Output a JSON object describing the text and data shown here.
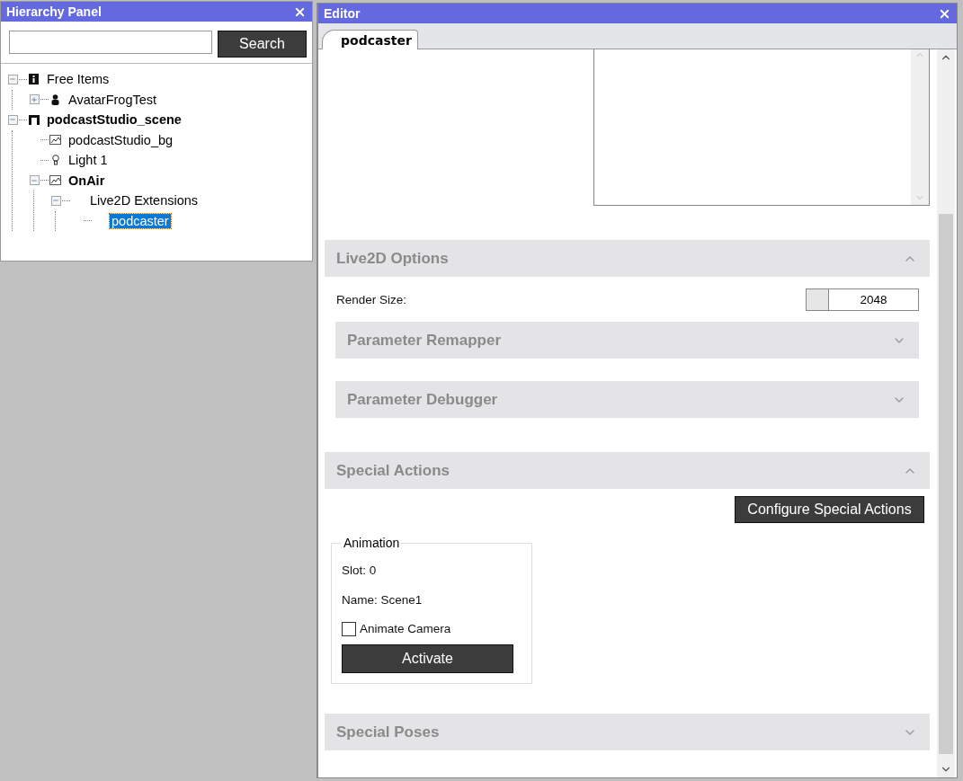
{
  "hierarchy_panel": {
    "title": "Hierarchy Panel",
    "search_button": "Search",
    "tree": [
      {
        "label": "Free Items",
        "kind": "info",
        "bold": false,
        "expanded": true,
        "selected": false,
        "children": [
          {
            "label": "AvatarFrogTest",
            "kind": "person",
            "bold": false,
            "expanded": false,
            "selected": false
          }
        ]
      },
      {
        "label": "podcastStudio_scene",
        "kind": "scene",
        "bold": true,
        "expanded": true,
        "selected": false,
        "children": [
          {
            "label": "podcastStudio_bg",
            "kind": "image",
            "bold": false,
            "selected": false
          },
          {
            "label": "Light 1",
            "kind": "light",
            "bold": false,
            "selected": false
          },
          {
            "label": "OnAir",
            "kind": "image",
            "bold": true,
            "expanded": true,
            "selected": false,
            "children": [
              {
                "label": "Live2D Extensions",
                "bold": false,
                "expanded": true,
                "selected": false,
                "children": [
                  {
                    "label": "podcaster",
                    "bold": false,
                    "selected": true
                  }
                ]
              }
            ]
          }
        ]
      }
    ]
  },
  "editor": {
    "title": "Editor",
    "tabs": [
      {
        "label": "podcaster",
        "selected": true
      }
    ],
    "sections": [
      {
        "kind": "options",
        "title": "Live2D Options",
        "expanded": true,
        "render_size": {
          "label": "Render Size:",
          "value": "2048"
        },
        "subsections": [
          {
            "title": "Parameter Remapper",
            "expanded": false
          },
          {
            "title": "Parameter Debugger",
            "expanded": false
          }
        ]
      },
      {
        "kind": "actions",
        "title": "Special Actions",
        "expanded": true,
        "button": "Configure Special Actions",
        "group": {
          "title": "Animation",
          "slot": "Slot: 0",
          "name": "Name: Scene1",
          "checkbox": {
            "label": "Animate Camera",
            "checked": false
          },
          "button": "Activate"
        }
      },
      {
        "kind": "plain",
        "title": "Special Poses",
        "expanded": false
      }
    ]
  }
}
